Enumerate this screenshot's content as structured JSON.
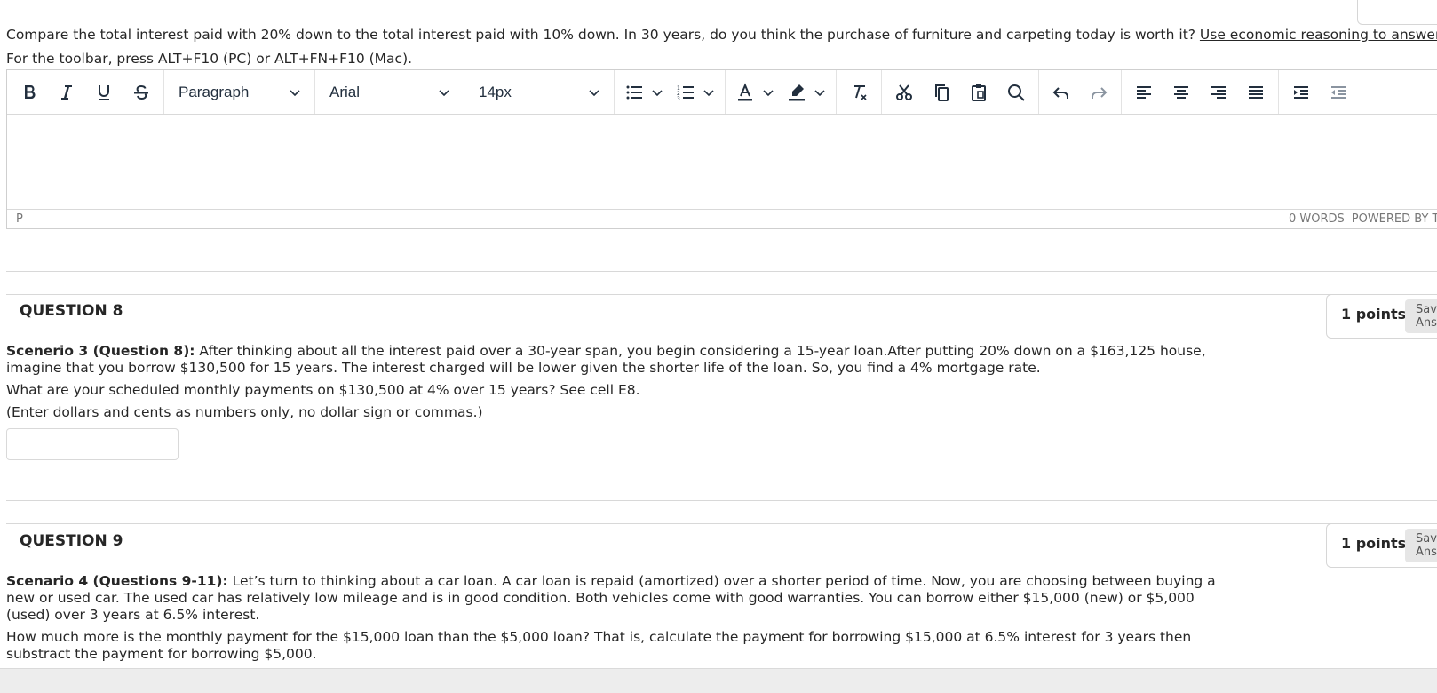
{
  "q7": {
    "prompt": "Compare the total interest paid with 20% down to the total interest paid with 10% down.  In 30 years, do you think the purchase of furniture and carpeting today is worth it? ",
    "prompt_link": "Use economic reasoning to answer.",
    "toolbar_hint": "For the toolbar, press ALT+F10 (PC) or ALT+FN+F10 (Mac)."
  },
  "editor": {
    "block_format": "Paragraph",
    "font_family": "Arial",
    "font_size": "14px",
    "status_path": "P",
    "word_count": "0 WORDS",
    "powered_by": "POWERED BY TINY"
  },
  "q8": {
    "title": "QUESTION 8",
    "points": "1 points",
    "save_label": "Save Answer",
    "scenario_label": "Scenerio 3 (Question 8):",
    "scenario_text_1": " After thinking about all the interest paid over a 30-year span, you begin considering a 15-year loan.After putting 20% down on a $163,125 house,",
    "scenario_text_2": "imagine that you borrow $130,500 for 15 years.  The interest charged will be lower given the shorter life of the loan. So, you find a 4% mortgage rate.",
    "question": "What are your scheduled monthly payments on $130,500 at 4% over 15 years?  See cell E8.",
    "instruction": "(Enter dollars and cents as numbers only, no dollar sign or commas.)",
    "answer_value": ""
  },
  "q9": {
    "title": "QUESTION 9",
    "points": "1 points",
    "save_label": "Save Answer",
    "scenario_label": "Scenario 4 (Questions 9-11):",
    "scenario_text_1": "   Let’s turn to thinking about a car loan.   A car loan is repaid (amortized) over a shorter period of time.  Now, you are choosing between buying a",
    "scenario_text_2": "new or used car.  The used car has relatively low mileage and is in good condition.  Both vehicles come with good warranties.  You can borrow either $15,000 (new) or $5,000",
    "scenario_text_3": "(used) over 3 years at 6.5% interest.",
    "question_1": "How much more is the monthly payment for the $15,000 loan than the $5,000 loan?  That is, calculate the payment for borrowing $15,000 at 6.5% interest for 3 years then",
    "question_2": "substract the payment for borrowing $5,000."
  },
  "colors": {
    "text": "#262626",
    "toolbar_icon": "#222f3e",
    "border": "#d6d6d6"
  }
}
